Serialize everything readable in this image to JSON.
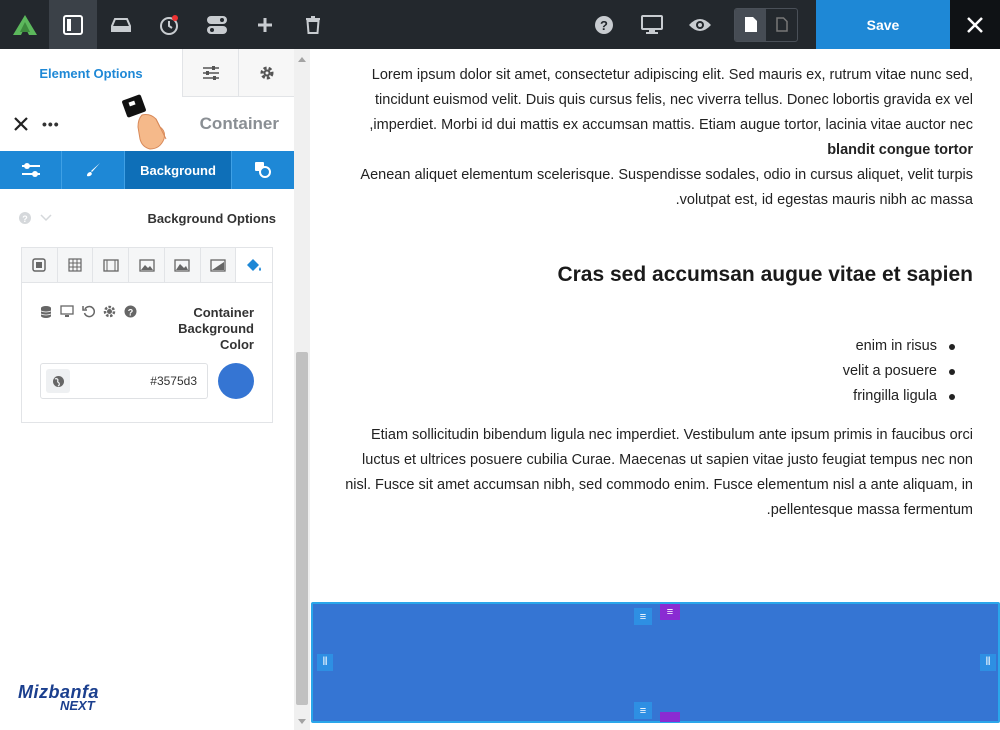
{
  "toolbar": {
    "save_label": "Save",
    "icons": [
      "avada-logo-icon",
      "layout-icon",
      "library-icon",
      "history-icon",
      "toggle-icon",
      "add-icon",
      "trash-icon",
      "help-icon",
      "desktop-icon",
      "preview-icon",
      "page-icon",
      "page-outline-icon",
      "close-icon"
    ]
  },
  "panel": {
    "tab_element_options": "Element Options",
    "header_title": "Container",
    "header_more": "•••",
    "subtab_background": "Background",
    "background_options_title": "Background Options",
    "color_label": "Container Background Color",
    "color_value": "#3575d3",
    "color_swatch": "#3575d3"
  },
  "content": {
    "para1": "Lorem ipsum dolor sit amet, consectetur adipiscing elit. Sed mauris ex, rutrum vitae nunc sed, tincidunt euismod velit. Duis quis cursus felis, nec viverra tellus. Donec lobortis gravida ex vel imperdiet. Morbi id dui mattis ex accumsan mattis. Etiam augue tortor, lacinia vitae auctor nec,",
    "para1_bold": "blandit congue tortor",
    "para2": "Aenean aliquet elementum scelerisque. Suspendisse sodales, odio in cursus aliquet, velit turpis volutpat est, id egestas mauris nibh ac massa.",
    "heading": "Cras sed accumsan augue vitae et sapien",
    "list": [
      "enim in risus",
      "velit a posuere",
      "fringilla ligula"
    ],
    "para3": "Etiam sollicitudin bibendum ligula nec imperdiet. Vestibulum ante ipsum primis in faucibus orci luctus et ultrices posuere cubilia Curae. Maecenas ut sapien vitae justo feugiat tempus nec non nisl. Fusce sit amet accumsan nibh, sed commodo enim. Fusce elementum nisl a ante aliquam, in pellentesque massa fermentum."
  },
  "logo": {
    "line1": "Mizbanfa",
    "line2": "NEXT"
  },
  "colors": {
    "accent": "#1e88d6",
    "container_bg": "#3575d3",
    "topbar": "#23282d"
  }
}
